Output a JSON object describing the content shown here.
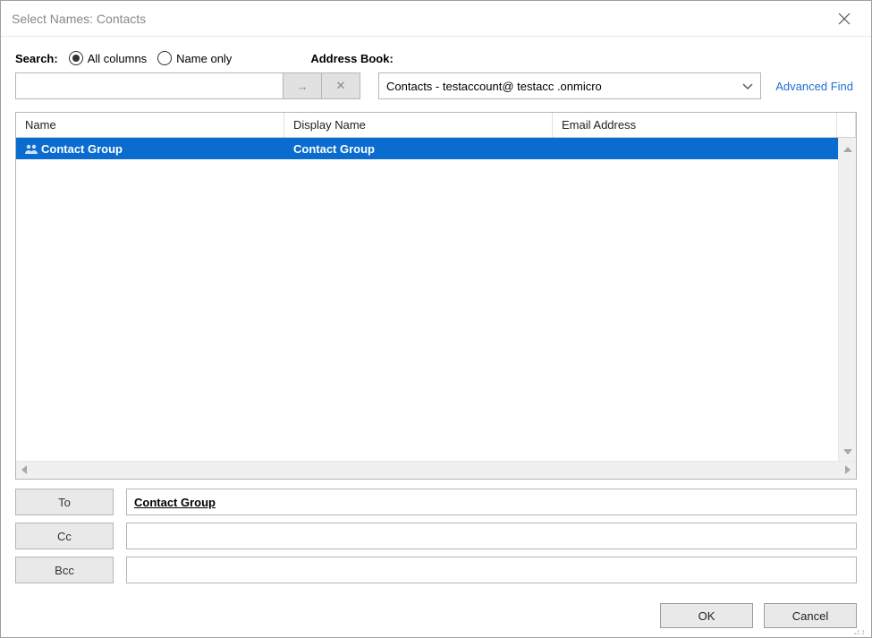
{
  "window": {
    "title": "Select Names: Contacts"
  },
  "search": {
    "label": "Search:",
    "radio_all": "All columns",
    "radio_name": "Name only",
    "value": ""
  },
  "address_book": {
    "label": "Address Book:",
    "selected": "Contacts - testaccount@  testacc .onmicro",
    "advanced_find": "Advanced Find"
  },
  "grid": {
    "columns": {
      "name": "Name",
      "display": "Display Name",
      "email": "Email Address"
    },
    "rows": [
      {
        "icon": "group-icon",
        "name": "Contact Group",
        "display": "Contact Group",
        "email": "",
        "selected": true
      }
    ]
  },
  "recipients": {
    "to": {
      "label": "To",
      "value": "Contact Group"
    },
    "cc": {
      "label": "Cc",
      "value": ""
    },
    "bcc": {
      "label": "Bcc",
      "value": ""
    }
  },
  "buttons": {
    "ok": "OK",
    "cancel": "Cancel"
  }
}
